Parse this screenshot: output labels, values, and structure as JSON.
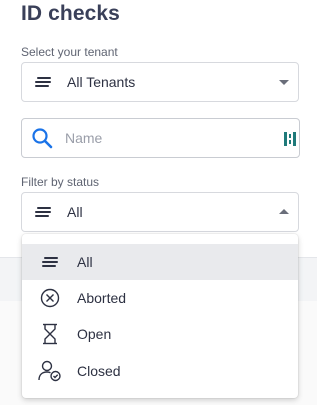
{
  "page": {
    "title": "ID checks"
  },
  "tenant": {
    "label": "Select your tenant",
    "value": "All Tenants",
    "icon": "list-lines-icon"
  },
  "search": {
    "placeholder": "Name",
    "icon": "search-icon",
    "scan_icon": "barcode-scan-icon",
    "accent_color": "#1a73e8"
  },
  "status_filter": {
    "label": "Filter by status",
    "value": "All",
    "icon": "list-lines-icon",
    "options": [
      {
        "label": "All",
        "icon": "list-lines-icon",
        "selected": true
      },
      {
        "label": "Aborted",
        "icon": "circle-x-icon",
        "selected": false
      },
      {
        "label": "Open",
        "icon": "hourglass-icon",
        "selected": false
      },
      {
        "label": "Closed",
        "icon": "user-check-icon",
        "selected": false
      }
    ]
  }
}
